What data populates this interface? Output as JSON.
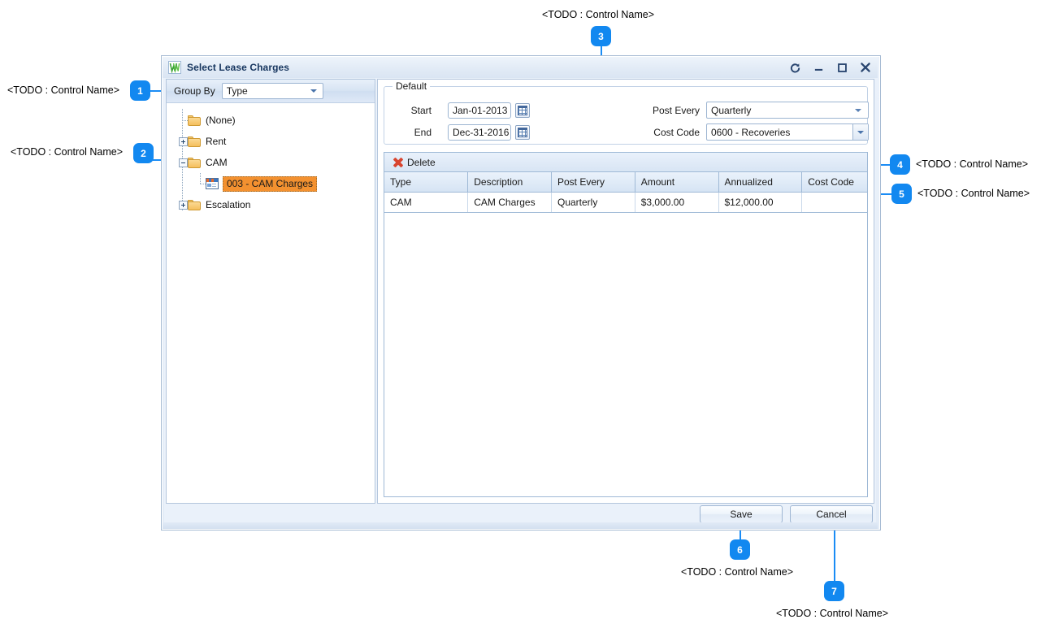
{
  "window": {
    "title": "Select Lease Charges",
    "logo_icon": "w-logo-icon",
    "controls": {
      "refresh": "refresh-icon",
      "minimize": "minimize-icon",
      "maximize": "maximize-icon",
      "close": "close-icon"
    }
  },
  "left_panel": {
    "group_by_label": "Group By",
    "group_by_value": "Type",
    "tree": [
      {
        "label": "(None)",
        "icon": "folder-icon",
        "toggle": "none",
        "level": 1,
        "selected": false
      },
      {
        "label": "Rent",
        "icon": "folder-icon",
        "toggle": "plus",
        "level": 1,
        "selected": false
      },
      {
        "label": "CAM",
        "icon": "folder-icon",
        "toggle": "minus",
        "level": 1,
        "selected": false
      },
      {
        "label": "003 - CAM Charges",
        "icon": "document-icon",
        "toggle": "none",
        "level": 2,
        "selected": true
      },
      {
        "label": "Escalation",
        "icon": "folder-icon",
        "toggle": "plus",
        "level": 1,
        "selected": false
      }
    ]
  },
  "default_group": {
    "title": "Default",
    "start_label": "Start",
    "start_value": "Jan-01-2013",
    "start_picker_icon": "calendar-icon",
    "end_label": "End",
    "end_value": "Dec-31-2016",
    "end_picker_icon": "calendar-icon",
    "post_every_label": "Post Every",
    "post_every_value": "Quarterly",
    "cost_code_label": "Cost Code",
    "cost_code_value": "0600 - Recoveries"
  },
  "grid": {
    "toolbar": {
      "delete_label": "Delete",
      "delete_icon": "red-x-icon"
    },
    "columns": [
      "Type",
      "Description",
      "Post Every",
      "Amount",
      "Annualized",
      "Cost Code"
    ],
    "rows": [
      [
        "CAM",
        "CAM Charges",
        "Quarterly",
        "$3,000.00",
        "$12,000.00",
        ""
      ]
    ]
  },
  "footer": {
    "save_label": "Save",
    "cancel_label": "Cancel"
  },
  "annotations": {
    "placeholder": "<TODO : Control Name>",
    "badges": [
      "1",
      "2",
      "3",
      "4",
      "5",
      "6",
      "7"
    ],
    "accent_color": "#1288f0"
  }
}
